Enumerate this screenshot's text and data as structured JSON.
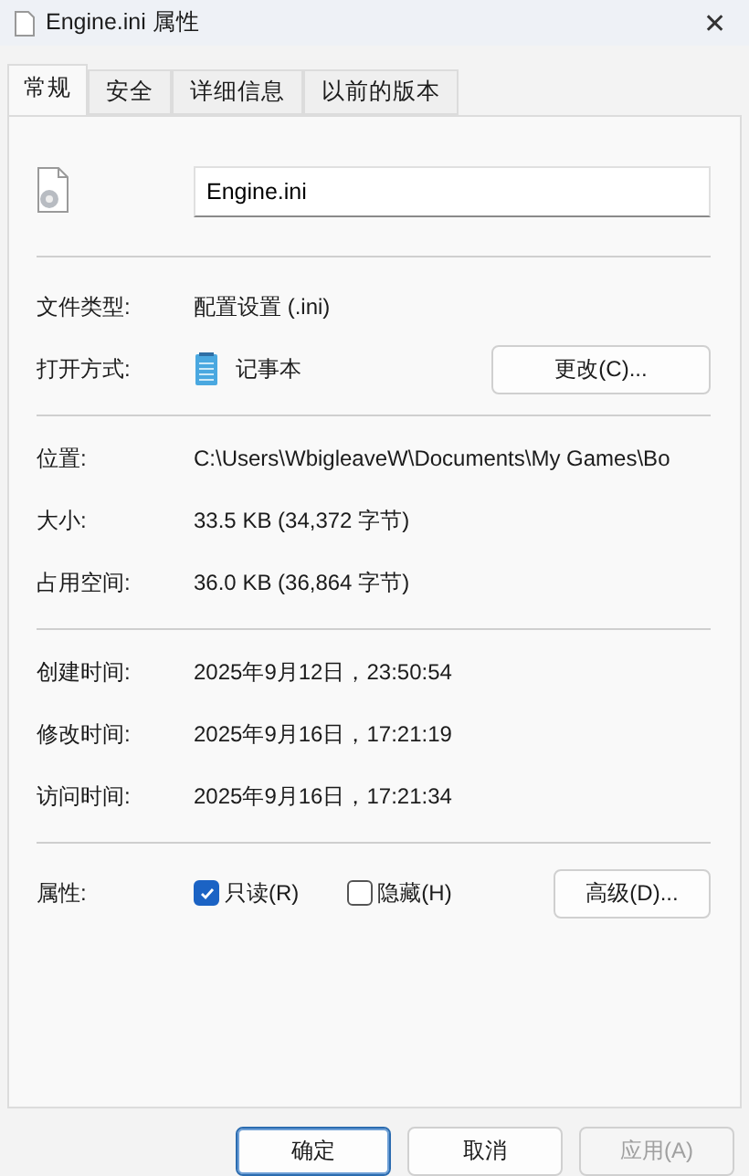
{
  "window": {
    "title": "Engine.ini 属性",
    "close": "✕"
  },
  "tabs": [
    {
      "label": "常规",
      "selected": true
    },
    {
      "label": "安全",
      "selected": false
    },
    {
      "label": "详细信息",
      "selected": false
    },
    {
      "label": "以前的版本",
      "selected": false
    }
  ],
  "file_name": {
    "value": "Engine.ini"
  },
  "type_section": [
    {
      "kind": "text",
      "label": "文件类型:",
      "value": "配置设置 (.ini)"
    },
    {
      "kind": "app",
      "label": "打开方式:",
      "value": "记事本",
      "button": "更改(C)..."
    }
  ],
  "location_section": [
    {
      "label": "位置:",
      "value": "C:\\Users\\WbigleaveW\\Documents\\My Games\\Bo"
    },
    {
      "label": "大小:",
      "value": "33.5 KB (34,372 字节)"
    },
    {
      "label": "占用空间:",
      "value": "36.0 KB (36,864 字节)"
    }
  ],
  "time_section": [
    {
      "label": "创建时间:",
      "value": "2025年9月12日，23:50:54"
    },
    {
      "label": "修改时间:",
      "value": "2025年9月16日，17:21:19"
    },
    {
      "label": "访问时间:",
      "value": "2025年9月16日，17:21:34"
    }
  ],
  "attributes": {
    "label": "属性:",
    "checkboxes": [
      {
        "label": "只读(R)",
        "checked": true
      },
      {
        "label": "隐藏(H)",
        "checked": false
      }
    ],
    "button": "高级(D)..."
  },
  "buttons": [
    {
      "label": "确定",
      "default": true,
      "disabled": false
    },
    {
      "label": "取消",
      "default": false,
      "disabled": false
    },
    {
      "label": "应用(A)",
      "default": false,
      "disabled": true
    }
  ]
}
